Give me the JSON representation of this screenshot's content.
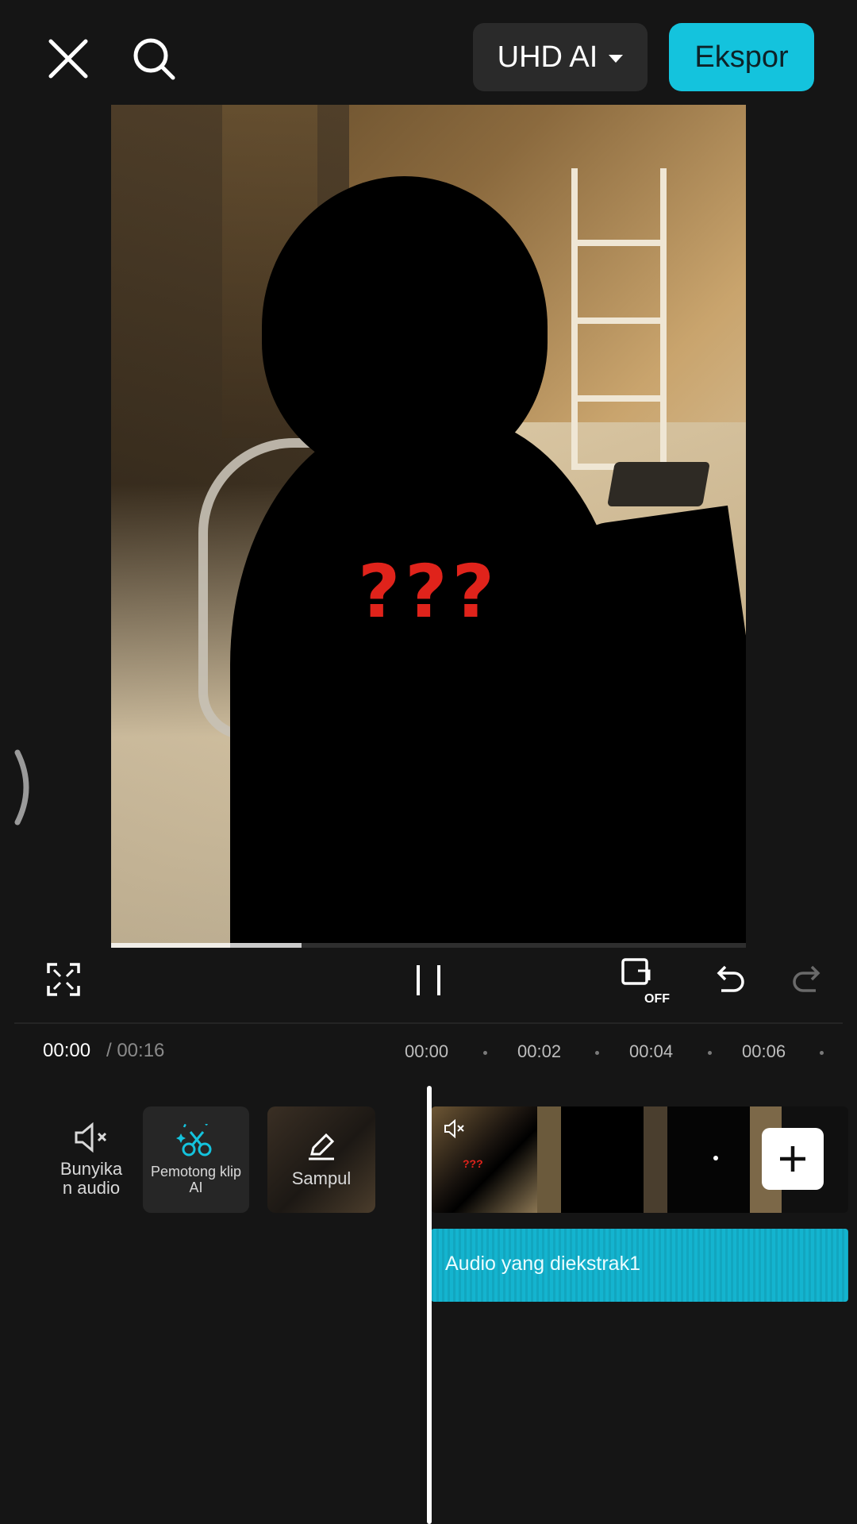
{
  "topbar": {
    "quality_label": "UHD AI",
    "export_label": "Ekspor"
  },
  "preview": {
    "overlay_text": "???",
    "progress": 0.3
  },
  "controls": {
    "keyframe_state": "OFF"
  },
  "timeline": {
    "current_time": "00:00",
    "total_time": "/ 00:16",
    "ruler": [
      "00:00",
      "00:02",
      "00:04",
      "00:06"
    ],
    "audio_track_label": "Audio yang diekstrak1",
    "thumb_overlay_text": "???"
  },
  "tools": {
    "mute_label": "Bunyikan audio",
    "mute_label_line1": "Bunyika",
    "mute_label_line2": "n audio",
    "cutter_label_line1": "Pemotong klip",
    "cutter_label_line2": "AI",
    "cover_label": "Sampul"
  },
  "colors": {
    "accent": "#14c3dd",
    "audio_track": "#14b4cf",
    "background": "#151515",
    "overlay_text": "#e0231b"
  },
  "icons": [
    "close-icon",
    "search-icon",
    "chevron-down-icon",
    "fullscreen-icon",
    "pause-icon",
    "keyframe-icon",
    "undo-icon",
    "redo-icon",
    "speaker-mute-icon",
    "ai-scissors-icon",
    "pencil-icon",
    "plus-icon"
  ]
}
